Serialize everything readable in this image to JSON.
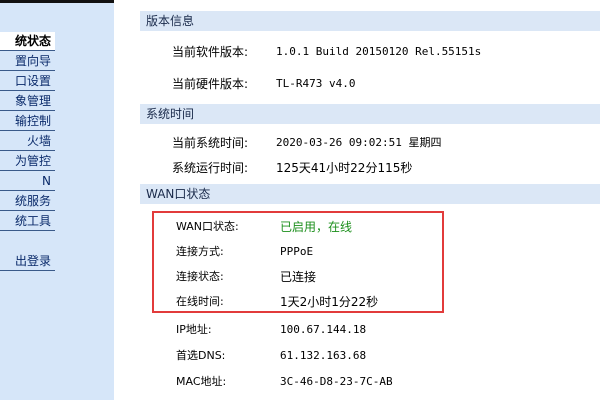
{
  "sidebar": {
    "items": [
      {
        "label": "统状态",
        "active": true
      },
      {
        "label": "置向导"
      },
      {
        "label": "口设置"
      },
      {
        "label": "象管理"
      },
      {
        "label": "输控制"
      },
      {
        "label": "火墙"
      },
      {
        "label": "为管控"
      },
      {
        "label": "N"
      },
      {
        "label": "统服务"
      },
      {
        "label": "统工具"
      },
      {
        "label": "出登录"
      }
    ]
  },
  "version": {
    "header": "版本信息",
    "software_label": "当前软件版本:",
    "software_value": "1.0.1 Build 20150120 Rel.55151s",
    "hardware_label": "当前硬件版本:",
    "hardware_value": "TL-R473 v4.0"
  },
  "system_time": {
    "header": "系统时间",
    "current_label": "当前系统时间:",
    "current_value": "2020-03-26 09:02:51 星期四",
    "uptime_label": "系统运行时间:",
    "uptime_value": "125天41小时22分115秒"
  },
  "wan": {
    "header": "WAN口状态",
    "status_label": "WAN口状态:",
    "status_value": "已启用，在线",
    "conn_type_label": "连接方式:",
    "conn_type_value": "PPPoE",
    "conn_state_label": "连接状态:",
    "conn_state_value": "已连接",
    "online_time_label": "在线时间:",
    "online_time_value": "1天2小时1分22秒",
    "ip_label": "IP地址:",
    "ip_value": "100.67.144.18",
    "dns_label": "首选DNS:",
    "dns_value": "61.132.163.68",
    "mac_label": "MAC地址:",
    "mac_value": "3C-46-D8-23-7C-AB"
  },
  "colors": {
    "highlight_border": "#e23b3b",
    "online_green": "#1c8f1c"
  }
}
